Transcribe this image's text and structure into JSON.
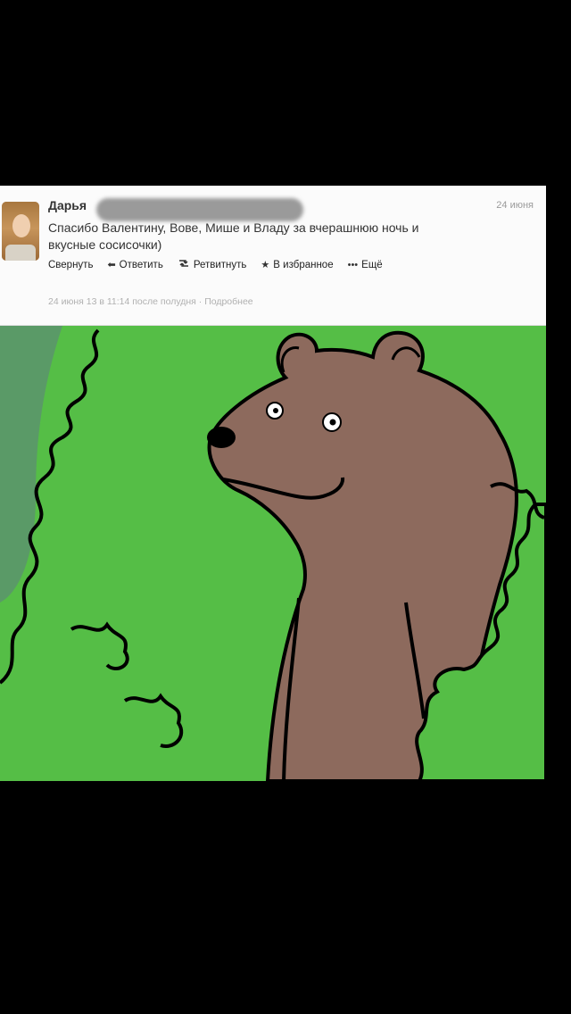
{
  "tweet": {
    "author_name": "Дарья",
    "date": "24 июня",
    "text_line1": "Спасибо Валентину, Вове, Мише и Владу за вчерашнюю ночь и",
    "text_line2": "вкусные сосисочки)",
    "actions": {
      "collapse": "Свернуть",
      "reply": "Ответить",
      "retweet": "Ретвитнуть",
      "favorite": "В избранное",
      "more": "Ещё"
    },
    "timestamp": "24 июня 13 в 11:14 после полудня",
    "separator": "·",
    "details": "Подробнее"
  },
  "icons": {
    "reply": "reply-arrow-icon",
    "retweet": "retweet-icon",
    "favorite": "star-icon",
    "more": "ellipsis-icon"
  },
  "colors": {
    "background": "#000000",
    "tweet_bg": "#fbfbfb",
    "bush_green": "#55be46",
    "bear_brown": "#8d6a5d"
  }
}
